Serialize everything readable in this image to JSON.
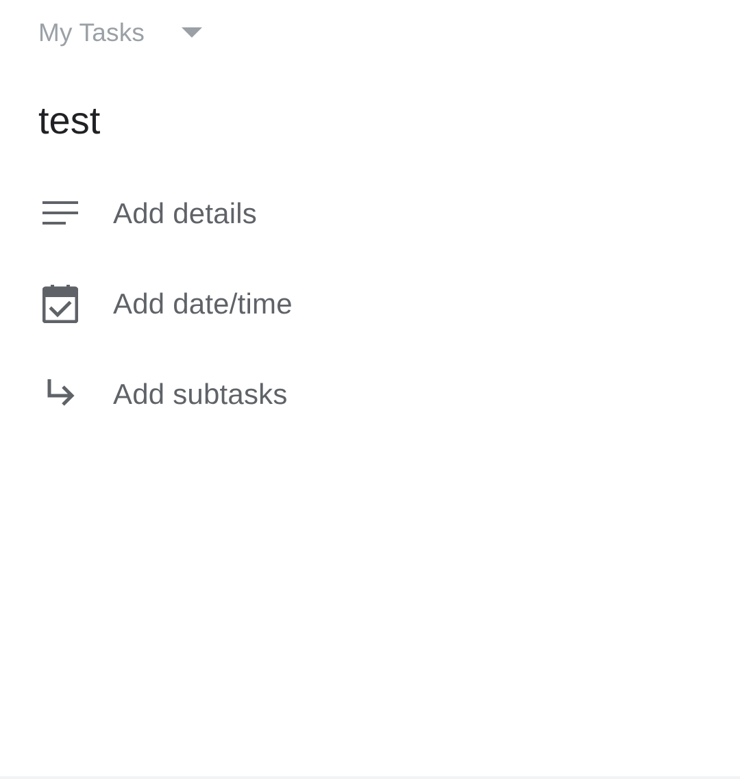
{
  "header": {
    "list_name": "My Tasks",
    "dropdown_icon": "arrow-drop-down-icon"
  },
  "task": {
    "title": "test"
  },
  "actions": [
    {
      "icon": "notes-icon",
      "label": "Add details"
    },
    {
      "icon": "calendar-check-icon",
      "label": "Add date/time"
    },
    {
      "icon": "subdirectory-arrow-icon",
      "label": "Add subtasks"
    }
  ],
  "colors": {
    "header_text": "#9aa0a6",
    "title_text": "#202124",
    "action_text": "#5f6368",
    "icon": "#5f6368"
  }
}
